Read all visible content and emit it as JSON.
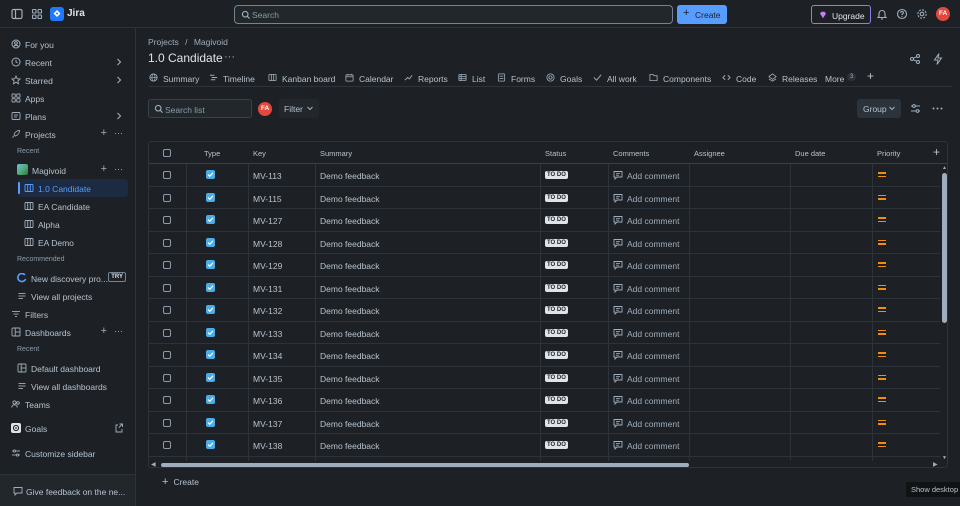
{
  "topbar": {
    "app_name": "Jira",
    "search_placeholder": "Search",
    "create_label": "Create",
    "upgrade_label": "Upgrade",
    "avatar_initials": "FA"
  },
  "sidebar": {
    "for_you": "For you",
    "recent": "Recent",
    "starred": "Starred",
    "apps": "Apps",
    "plans": "Plans",
    "projects": "Projects",
    "recent_heading": "Recent",
    "project_name": "Magivoid",
    "boards": [
      "1.0 Candidate",
      "EA Candidate",
      "Alpha",
      "EA Demo"
    ],
    "recommended_heading": "Recommended",
    "discovery": "New discovery pro...",
    "try_badge": "TRY",
    "view_all_projects": "View all projects",
    "filters": "Filters",
    "dashboards": "Dashboards",
    "dash_recent_heading": "Recent",
    "default_dashboard": "Default dashboard",
    "view_all_dashboards": "View all dashboards",
    "teams": "Teams",
    "goals": "Goals",
    "customize": "Customize sidebar",
    "feedback": "Give feedback on the ne..."
  },
  "header": {
    "breadcrumb_projects": "Projects",
    "breadcrumb_separator": "/",
    "breadcrumb_project": "Magivoid",
    "title": "1.0 Candidate",
    "more": "···"
  },
  "tabs": [
    {
      "label": "Summary",
      "icon": "globe-icon"
    },
    {
      "label": "Timeline",
      "icon": "timeline-icon"
    },
    {
      "label": "Kanban board",
      "icon": "board-icon"
    },
    {
      "label": "Calendar",
      "icon": "calendar-icon"
    },
    {
      "label": "Reports",
      "icon": "chart-icon"
    },
    {
      "label": "List",
      "icon": "list-icon"
    },
    {
      "label": "Forms",
      "icon": "forms-icon"
    },
    {
      "label": "Goals",
      "icon": "goals-icon"
    },
    {
      "label": "All work",
      "icon": "all-work-icon"
    },
    {
      "label": "Components",
      "icon": "components-icon"
    },
    {
      "label": "Code",
      "icon": "code-icon"
    },
    {
      "label": "Releases",
      "icon": "releases-icon"
    }
  ],
  "tabs_more": {
    "label": "More",
    "count": "3"
  },
  "toolbar": {
    "search_placeholder": "Search list",
    "avatar_initials": "FA",
    "filter_label": "Filter",
    "group_label": "Group"
  },
  "table": {
    "columns": [
      "Type",
      "Key",
      "Summary",
      "Status",
      "Comments",
      "Assignee",
      "Due date",
      "Priority"
    ],
    "rows": [
      {
        "key": "MV-113",
        "summary": "Demo feedback",
        "status": "TO DO",
        "comment": "Add comment"
      },
      {
        "key": "MV-115",
        "summary": "Demo feedback",
        "status": "TO DO",
        "comment": "Add comment"
      },
      {
        "key": "MV-127",
        "summary": "Demo feedback",
        "status": "TO DO",
        "comment": "Add comment"
      },
      {
        "key": "MV-128",
        "summary": "Demo feedback",
        "status": "TO DO",
        "comment": "Add comment"
      },
      {
        "key": "MV-129",
        "summary": "Demo feedback",
        "status": "TO DO",
        "comment": "Add comment"
      },
      {
        "key": "MV-131",
        "summary": "Demo feedback",
        "status": "TO DO",
        "comment": "Add comment"
      },
      {
        "key": "MV-132",
        "summary": "Demo feedback",
        "status": "TO DO",
        "comment": "Add comment"
      },
      {
        "key": "MV-133",
        "summary": "Demo feedback",
        "status": "TO DO",
        "comment": "Add comment"
      },
      {
        "key": "MV-134",
        "summary": "Demo feedback",
        "status": "TO DO",
        "comment": "Add comment"
      },
      {
        "key": "MV-135",
        "summary": "Demo feedback",
        "status": "TO DO",
        "comment": "Add comment"
      },
      {
        "key": "MV-136",
        "summary": "Demo feedback",
        "status": "TO DO",
        "comment": "Add comment"
      },
      {
        "key": "MV-137",
        "summary": "Demo feedback",
        "status": "TO DO",
        "comment": "Add comment"
      },
      {
        "key": "MV-138",
        "summary": "Demo feedback",
        "status": "TO DO",
        "comment": "Add comment"
      }
    ],
    "create_label": "Create"
  },
  "tooltip": "Show desktop",
  "colors": {
    "background": "#1d2125",
    "accent": "#579dff",
    "priority_medium": "#f18d13",
    "task_type": "#4bade8"
  }
}
